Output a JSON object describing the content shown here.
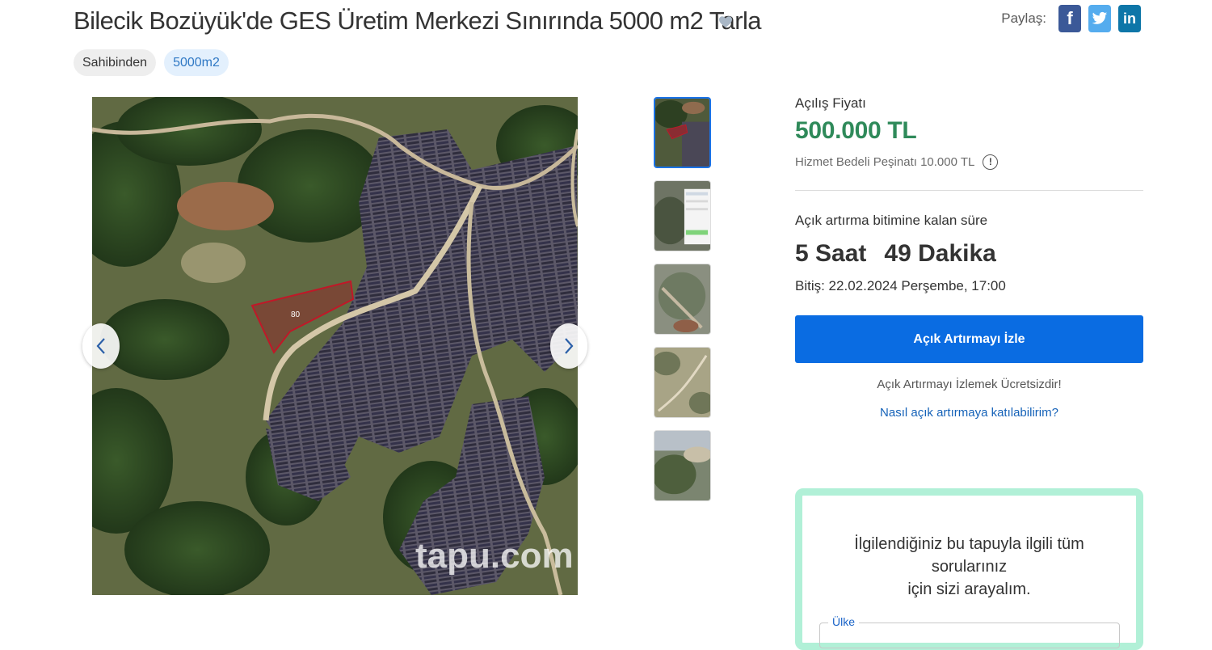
{
  "listing": {
    "title": "Bilecik Bozüyük'de GES Üretim Merkezi Sınırında 5000 m2 Tarla",
    "tags": [
      "Sahibinden",
      "5000m2"
    ]
  },
  "share": {
    "label": "Paylaş:",
    "buttons": [
      {
        "icon": "facebook-icon",
        "glyph": "f",
        "color": "#3b5998"
      },
      {
        "icon": "twitter-icon",
        "glyph": "t",
        "color": "#55acee"
      },
      {
        "icon": "linkedin-icon",
        "glyph": "in",
        "color": "#0e76a8"
      }
    ]
  },
  "gallery": {
    "parcel_label": "80",
    "watermark": "tapu.com",
    "thumbnail_count": 5,
    "active_thumbnail": 1
  },
  "auction": {
    "opening_label": "Açılış Fiyatı",
    "opening_price": "500.000 TL",
    "fee_text": "Hizmet Bedeli Peşinatı 10.000 TL",
    "remaining_label": "Açık artırma bitimine kalan süre",
    "hours": "5 Saat",
    "minutes": "49 Dakika",
    "end_text": "Bitiş: 22.02.2024 Perşembe, 17:00",
    "watch_button": "Açık Artırmayı İzle",
    "free_note": "Açık Artırmayı İzlemek Ücretsizdir!",
    "howto_link": "Nasıl açık artırmaya katılabilirim?"
  },
  "callback": {
    "text_line1": "İlgilendiğiniz bu tapuyla ilgili tüm sorularınız",
    "text_line2": "için sizi arayalım.",
    "country_label": "Ülke"
  },
  "colors": {
    "price": "#2f8a5a",
    "primary_button": "#0a6ce2",
    "callback_border": "#b1f0d7",
    "link": "#1562b8"
  }
}
